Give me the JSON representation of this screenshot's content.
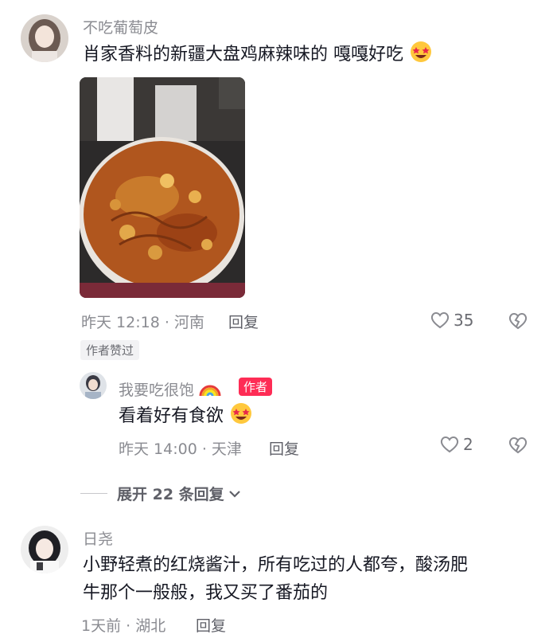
{
  "comments": [
    {
      "username": "不吃葡萄皮",
      "text": "肖家香料的新疆大盘鸡麻辣味的 嘎嘎好吃",
      "time_location": "昨天 12:18 · 河南",
      "reply_label": "回复",
      "like_count": "35",
      "author_liked_label": "作者赞过",
      "replies": [
        {
          "username": "我要吃很饱",
          "author_badge": "作者",
          "text": "看着好有食欲",
          "time_location": "昨天 14:00 · 天津",
          "reply_label": "回复",
          "like_count": "2"
        }
      ],
      "expand_label": "展开 22 条回复"
    },
    {
      "username": "日尧",
      "text_line1": "小野轻煮的红烧酱汁，所有吃过的人都夸，酸汤肥",
      "text_line2": "牛那个一般般，我又买了番茄的",
      "time_location": "1天前 · 湖北",
      "reply_label": "回复"
    }
  ],
  "icons": {
    "like": "heart-outline-icon",
    "dislike": "broken-heart-icon",
    "emoji": "star-struck-emoji-icon",
    "rainbow": "rainbow-emoji-icon",
    "expand": "chevron-down-icon"
  },
  "colors": {
    "author_badge": "#fe2c55",
    "username": "#8a8b91",
    "text": "#161823"
  }
}
